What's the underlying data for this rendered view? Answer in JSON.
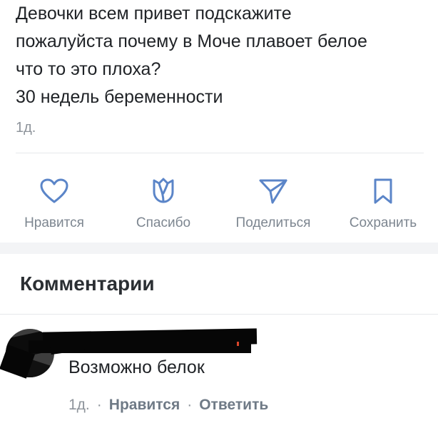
{
  "post": {
    "lines": [
      "Девочки всем привет подскажите",
      "пожалуйста почему в Моче плавоет белое",
      "что то это плоха?",
      "30 недель беременности"
    ],
    "time": "1д."
  },
  "actions": {
    "like": "Нравится",
    "thanks": "Спасибо",
    "share": "Поделиться",
    "save": "Сохранить"
  },
  "comments_title": "Комментарии",
  "comment": {
    "text": "Возможно белок",
    "time": "1д.",
    "separator": "·",
    "like": "Нравится",
    "reply": "Ответить"
  },
  "colors": {
    "text": "#1f2226",
    "muted": "#7d8690",
    "divider": "#e6e8eb",
    "section_gap": "#f3f4f6"
  },
  "icons": {
    "like": "heart-icon",
    "thanks": "tulip-icon",
    "share": "send-icon",
    "save": "bookmark-icon"
  }
}
